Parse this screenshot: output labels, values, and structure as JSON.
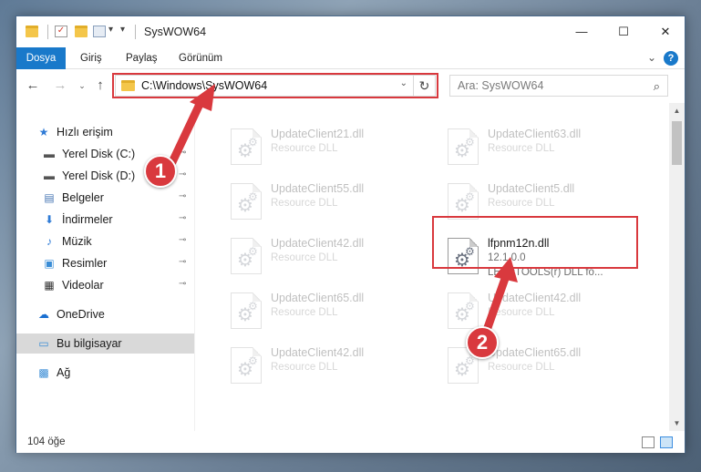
{
  "window": {
    "title": "SysWOW64",
    "controls": {
      "minimize": "—",
      "maximize": "☐",
      "close": "✕"
    }
  },
  "ribbon": {
    "tabs": [
      "Dosya",
      "Giriş",
      "Paylaş",
      "Görünüm"
    ],
    "expand_glyph": "⌄",
    "help_glyph": "?"
  },
  "navigation": {
    "back_glyph": "←",
    "forward_glyph": "→",
    "recent_glyph": "⌄",
    "up_glyph": "↑",
    "address": "C:\\Windows\\SysWOW64",
    "refresh_glyph": "↻",
    "search_placeholder": "Ara: SysWOW64",
    "search_glyph": "⌕"
  },
  "sidebar": {
    "items": [
      {
        "label": "Hızlı erişim",
        "icon": "star-icon",
        "glyph": "★",
        "color": "#2f7bd6"
      },
      {
        "label": "Yerel Disk (C:)",
        "icon": "drive-icon",
        "glyph": "▬",
        "color": "#555555",
        "pinned": true
      },
      {
        "label": "Yerel Disk (D:)",
        "icon": "drive-icon",
        "glyph": "▬",
        "color": "#555555",
        "pinned": true
      },
      {
        "label": "Belgeler",
        "icon": "documents-icon",
        "glyph": "▤",
        "color": "#4a78b5",
        "pinned": true
      },
      {
        "label": "İndirmeler",
        "icon": "download-icon",
        "glyph": "⬇",
        "color": "#2f7bd6",
        "pinned": true
      },
      {
        "label": "Müzik",
        "icon": "music-icon",
        "glyph": "♪",
        "color": "#2f7bd6",
        "pinned": true
      },
      {
        "label": "Resimler",
        "icon": "pictures-icon",
        "glyph": "▣",
        "color": "#3a8dd6",
        "pinned": true
      },
      {
        "label": "Videolar",
        "icon": "video-icon",
        "glyph": "▦",
        "color": "#333333",
        "pinned": true
      },
      {
        "label": "OneDrive",
        "icon": "cloud-icon",
        "glyph": "☁",
        "color": "#1a6fd1"
      },
      {
        "label": "Bu bilgisayar",
        "icon": "computer-icon",
        "glyph": "▭",
        "color": "#3a8dd6",
        "selected": true
      },
      {
        "label": "Ağ",
        "icon": "network-icon",
        "glyph": "▩",
        "color": "#3a8dd6"
      }
    ],
    "pin_glyph": "📌"
  },
  "files": [
    {
      "name": "UpdateClient21.dll",
      "desc": "Resource DLL",
      "faded": true
    },
    {
      "name": "UpdateClient63.dll",
      "desc": "Resource DLL",
      "faded": true
    },
    {
      "name": "UpdateClient55.dll",
      "desc": "Resource DLL",
      "faded": true
    },
    {
      "name": "UpdateClient5.dll",
      "desc": "Resource DLL",
      "faded": true
    },
    {
      "name": "UpdateClient42.dll",
      "desc": "Resource DLL",
      "faded": true
    },
    {
      "name": "lfpnm12n.dll",
      "desc": "12.1.0.0",
      "desc2": "LEADTOOLS(r) DLL fo...",
      "faded": false
    },
    {
      "name": "UpdateClient65.dll",
      "desc": "Resource DLL",
      "faded": true
    },
    {
      "name": "UpdateClient42.dll",
      "desc": "Resource DLL",
      "faded": true
    },
    {
      "name": "UpdateClient42.dll",
      "desc": "Resource DLL",
      "faded": true
    },
    {
      "name": "UpdateClient65.dll",
      "desc": "Resource DLL",
      "faded": true
    }
  ],
  "status": {
    "count": "104 öğe"
  },
  "callouts": {
    "one": "1",
    "two": "2"
  },
  "colors": {
    "accent": "#1979ca",
    "highlight": "#d9393e"
  }
}
